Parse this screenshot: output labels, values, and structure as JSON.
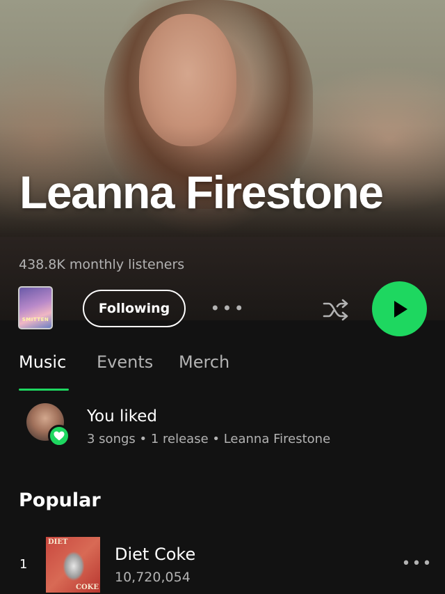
{
  "artist": {
    "name": "Leanna Firestone",
    "monthly_listeners": "438.8K monthly listeners"
  },
  "actions": {
    "cover_text": "SMITTEN",
    "follow_label": "Following",
    "more_label": "•••",
    "shuffle_icon": "shuffle-icon",
    "play_icon": "play-icon"
  },
  "tabs": [
    {
      "label": "Music",
      "active": true
    },
    {
      "label": "Events",
      "active": false
    },
    {
      "label": "Merch",
      "active": false
    }
  ],
  "liked": {
    "title": "You liked",
    "subtitle": "3 songs • 1 release • Leanna Firestone",
    "icon": "heart-icon"
  },
  "popular": {
    "heading": "Popular",
    "tracks": [
      {
        "rank": "1",
        "title": "Diet Coke",
        "plays": "10,720,054",
        "art_top": "DIET",
        "art_bottom": "COKE",
        "more_label": "•••"
      }
    ]
  },
  "colors": {
    "accent": "#1ed760",
    "background": "#121212",
    "secondary_text": "#b3b3b3"
  }
}
